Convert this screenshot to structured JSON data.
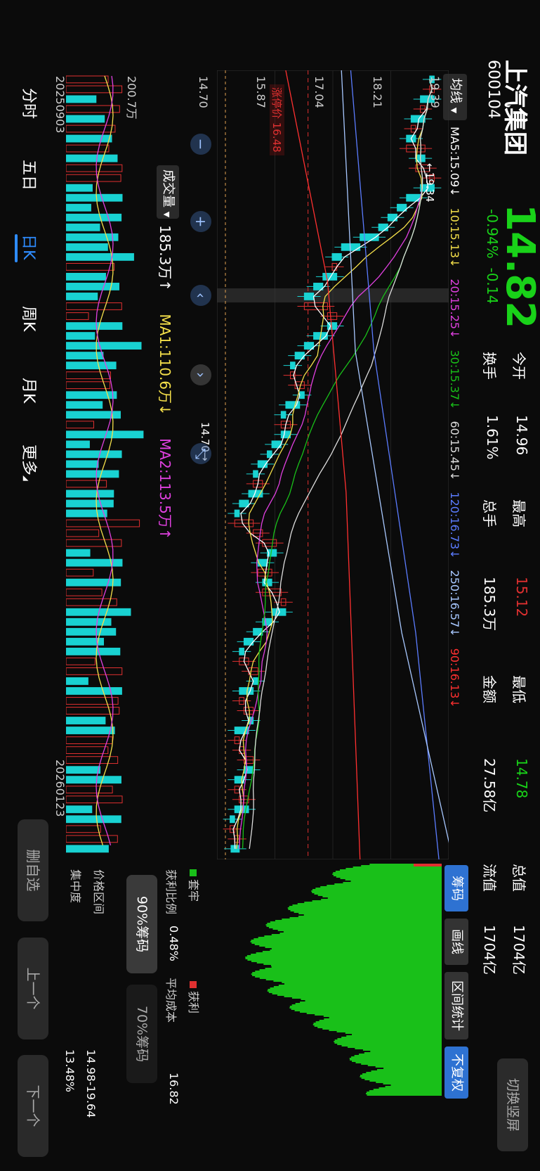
{
  "stock": {
    "name": "上汽集团",
    "code": "600104",
    "price": "14.82",
    "change_pct": "-0.94%",
    "change": "-0.14"
  },
  "quote": {
    "open_label": "今开",
    "open": "14.96",
    "turnover_label": "换手",
    "turnover": "1.61%",
    "high_label": "最高",
    "high": "15.12",
    "volume_label": "总手",
    "volume": "185.3万",
    "low_label": "最低",
    "low": "14.78",
    "amount_label": "金额",
    "amount": "27.58亿",
    "mktcap_label": "总值",
    "mktcap": "1704亿",
    "float_label": "流值",
    "float": "1704亿"
  },
  "switch_label": "切换竖屏",
  "ma": {
    "toggle": "均线",
    "items": [
      {
        "text": "MA5:15.09↓",
        "color": "#ffffff"
      },
      {
        "text": "10:15.13↓",
        "color": "#f5e04a"
      },
      {
        "text": "20:15.25↓",
        "color": "#e040e0"
      },
      {
        "text": "30:15.37↓",
        "color": "#19c019"
      },
      {
        "text": "60:15.45↓",
        "color": "#dddddd"
      },
      {
        "text": "120:16.73↓",
        "color": "#5b7cff"
      },
      {
        "text": "250:16.57↓",
        "color": "#a8c8ff"
      },
      {
        "text": "90:16.13↓",
        "color": "#ff3030"
      }
    ]
  },
  "tabs_right": {
    "chip": "筹码",
    "draw": "画线",
    "range": "区间统计",
    "adjust": "不复权"
  },
  "kline": {
    "price_labels": [
      "19.39",
      "18.21",
      "17.04",
      "15.87",
      "14.70"
    ],
    "max_marker": "←19.34",
    "min_marker": "14.70→",
    "limit_label": "涨停价 16.48"
  },
  "volume": {
    "toggle": "成交量",
    "axis_top": "200.7万",
    "axis_bottom": "0",
    "vol": "185.3万↑",
    "ma1": "MA1:110.6万↓",
    "ma2": "MA2:113.5万↑",
    "date_start": "20250903",
    "date_end": "20260123"
  },
  "bottom_tabs": [
    "分时",
    "五日",
    "日K",
    "周K",
    "月K",
    "更多"
  ],
  "active_tab": "日K",
  "chip_panel": {
    "legend_trap": "套牢",
    "legend_profit": "获利",
    "profit_ratio_label": "获利比例",
    "profit_ratio": "0.48%",
    "avg_cost_label": "平均成本",
    "avg_cost": "16.82",
    "btn90": "90%筹码",
    "btn70": "70%筹码",
    "range_label": "价格区间",
    "range": "14.98-19.64",
    "conc_label": "集中度",
    "conc": "13.48%"
  },
  "side_buttons": {
    "del": "删自选",
    "prev": "上一个",
    "next": "下一个"
  },
  "colors": {
    "up": "#e03030",
    "down": "#19d2d2",
    "green": "#19d219"
  },
  "chart_data": {
    "type": "candlestick",
    "closes": [
      19.1,
      19.2,
      18.9,
      19.0,
      18.7,
      18.8,
      18.6,
      19.0,
      18.8,
      19.1,
      19.2,
      18.9,
      18.6,
      18.4,
      18.2,
      18.0,
      17.6,
      17.2,
      17.0,
      17.1,
      16.8,
      16.6,
      16.4,
      16.9,
      17.1,
      16.9,
      16.6,
      16.4,
      16.2,
      16.1,
      16.2,
      16.4,
      16.3,
      16.0,
      15.9,
      16.1,
      15.9,
      15.7,
      15.6,
      15.4,
      15.3,
      15.5,
      15.2,
      15.0,
      14.9,
      15.3,
      15.5,
      15.8,
      15.6,
      15.4,
      15.7,
      15.5,
      15.9,
      16.0,
      15.7,
      15.5,
      15.3,
      15.1,
      15.0,
      15.2,
      15.4,
      15.3,
      15.0,
      15.1,
      15.3,
      15.2,
      14.9,
      15.0,
      15.1,
      15.3,
      15.1,
      14.9,
      15.0,
      15.2,
      14.9,
      14.8,
      14.9,
      15.0,
      14.82
    ],
    "ylim": [
      14.7,
      19.39
    ]
  }
}
